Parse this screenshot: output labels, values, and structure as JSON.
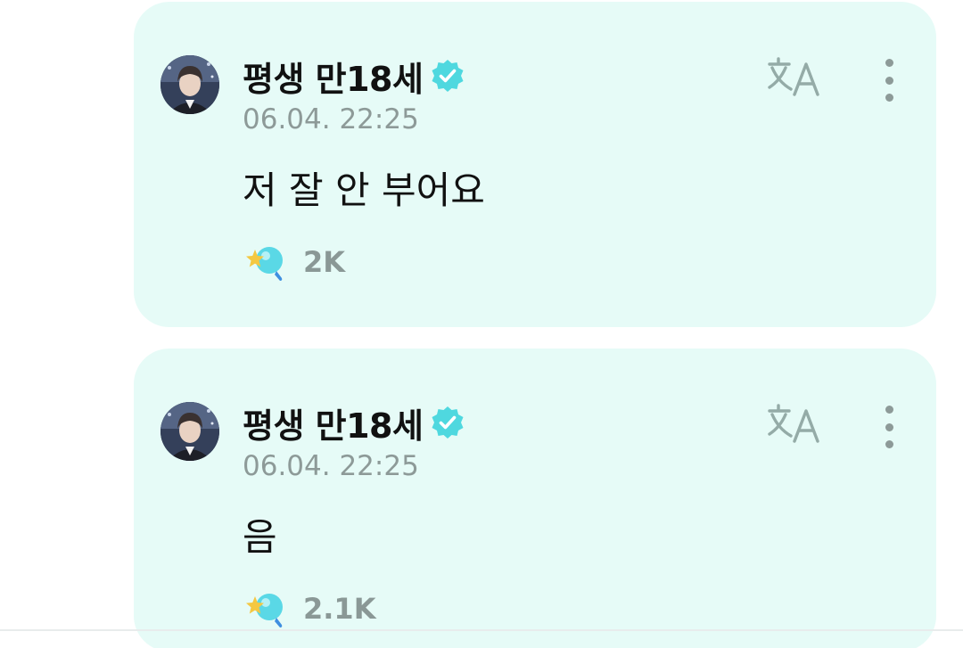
{
  "posts": [
    {
      "author": "평생 만18세",
      "verified": true,
      "timestamp": "06.04. 22:25",
      "text": "저 잘 안 부어요",
      "reaction_count": "2K"
    },
    {
      "author": "평생 만18세",
      "verified": true,
      "timestamp": "06.04. 22:25",
      "text": "음",
      "reaction_count": "2.1K"
    }
  ],
  "colors": {
    "card_bg": "#e6fbf7",
    "verified_badge": "#4fd8df",
    "muted_text": "#8d9a98",
    "reaction_star": "#f4c842",
    "reaction_bubble": "#5ad8e6"
  },
  "icons": {
    "translate": "translate-icon",
    "more": "more-vertical-icon",
    "verified": "verified-badge-icon",
    "reaction": "lightstick-reaction-icon"
  }
}
